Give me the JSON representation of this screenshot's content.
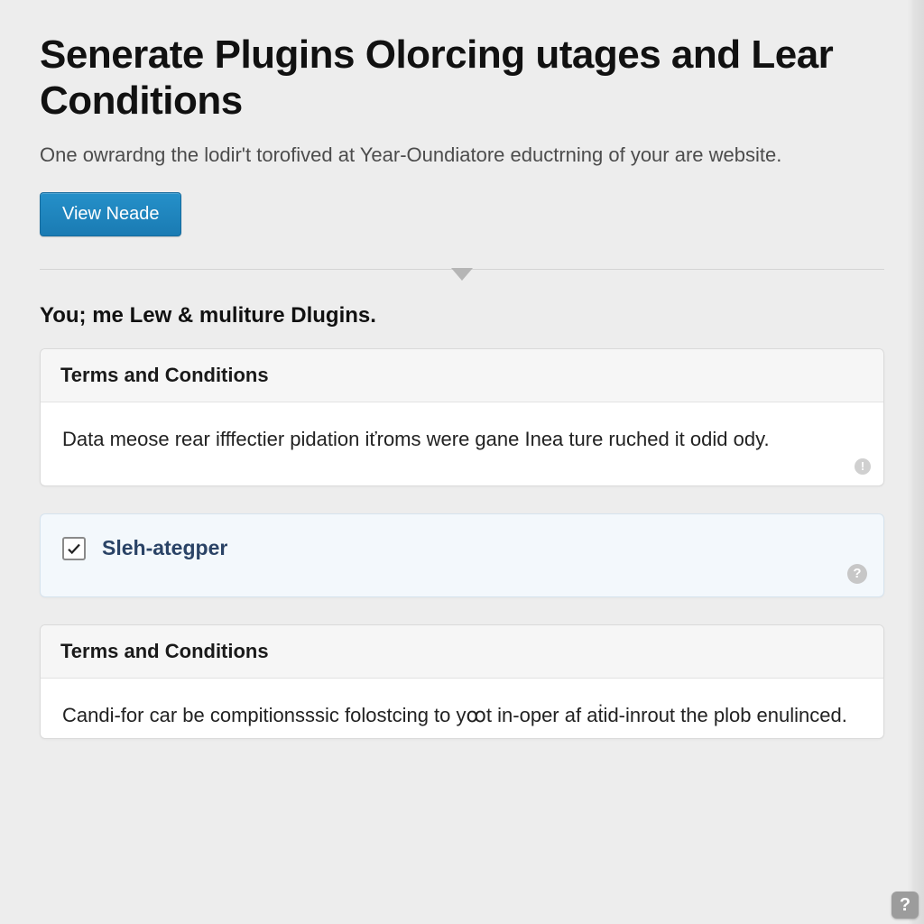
{
  "header": {
    "title": "Senerate Plugins Olorcing utages and Lear Conditions",
    "subtitle": "One owrardng the lodir't torofived at Year‑Oundiatore eductrning of your are website.",
    "primary_button": "View Neade"
  },
  "section": {
    "heading": "You; me Lew & muliture Dlugins."
  },
  "cards": {
    "terms1": {
      "title": "Terms and Conditions",
      "body": "Data meose rear ifffectier pidation iťroms were gane Inea ture ruched it odid ody.",
      "info_glyph": "!"
    },
    "option": {
      "label": "Sleh-ategper",
      "checked": true,
      "help_glyph": "?"
    },
    "terms2": {
      "title": "Terms and Conditions",
      "body": "Candi-for car be compitionsssic folostcing to yꝏt in-oper af aṫid-inrout the plob enulinced."
    }
  },
  "floating_help": "?"
}
